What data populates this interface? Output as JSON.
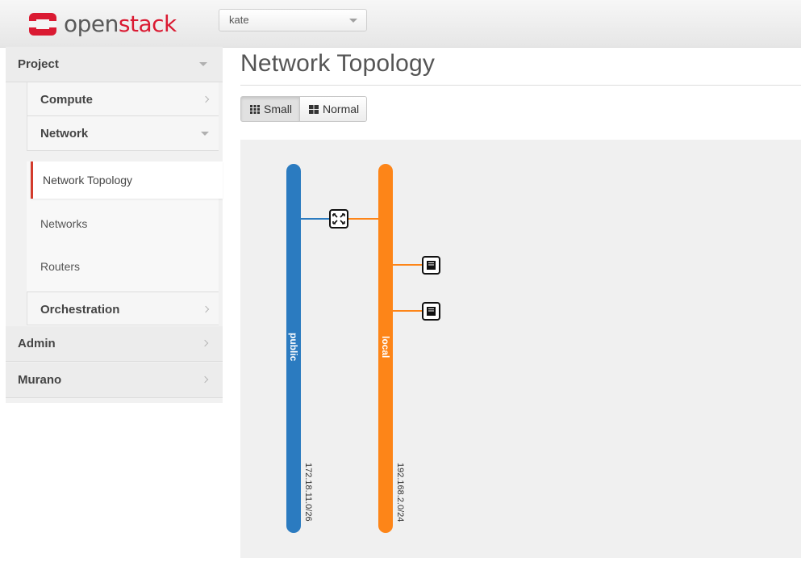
{
  "header": {
    "logo": {
      "text_a": "open",
      "text_b": "stack"
    },
    "project_select": {
      "value": "kate"
    }
  },
  "sidebar": {
    "project": {
      "label": "Project"
    },
    "compute": {
      "label": "Compute"
    },
    "network": {
      "label": "Network"
    },
    "network_items": [
      {
        "label": "Network Topology",
        "active": true
      },
      {
        "label": "Networks",
        "active": false
      },
      {
        "label": "Routers",
        "active": false
      }
    ],
    "orchestration": {
      "label": "Orchestration"
    },
    "admin": {
      "label": "Admin"
    },
    "murano": {
      "label": "Murano"
    }
  },
  "main": {
    "title": "Network Topology",
    "view_buttons": {
      "small": "Small",
      "normal": "Normal",
      "selected": "Small"
    }
  },
  "topology": {
    "networks": [
      {
        "name": "public",
        "cidr": "172.18.11.0/26",
        "color": "#2b7bc0"
      },
      {
        "name": "local",
        "cidr": "192.168.2.0/24",
        "color": "#fd8518"
      }
    ],
    "router": {
      "icon": "router-icon",
      "connects": [
        "public",
        "local"
      ]
    },
    "instances": [
      {
        "icon": "instance-icon",
        "network": "local"
      },
      {
        "icon": "instance-icon",
        "network": "local"
      }
    ]
  },
  "colors": {
    "brand_red": "#da1a32",
    "public_net": "#2b7bc0",
    "local_net": "#fd8518",
    "active_indicator": "#d33b2c"
  }
}
